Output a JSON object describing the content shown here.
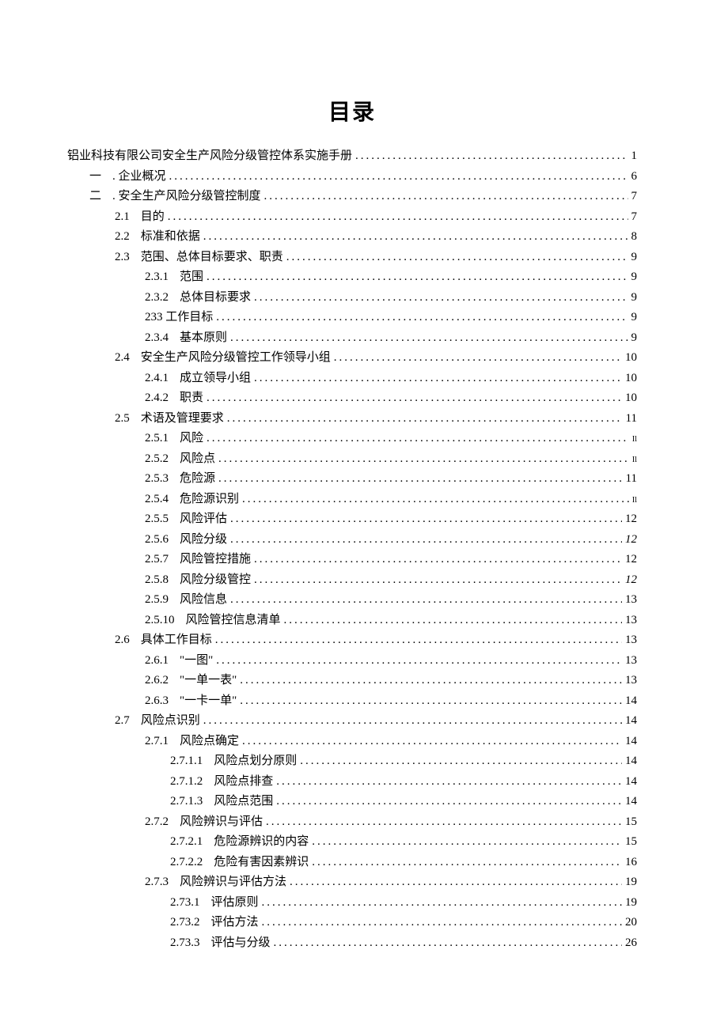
{
  "title": "目录",
  "toc": [
    {
      "level": 0,
      "num": "",
      "label": "铝业科技有限公司安全生产风险分级管控体系实施手册",
      "page": "1"
    },
    {
      "level": 1,
      "num": "一",
      "label": ". 企业概况",
      "page": "6"
    },
    {
      "level": 1,
      "num": "二",
      "label": ". 安全生产风险分级管控制度",
      "page": "7"
    },
    {
      "level": 2,
      "num": "2.1",
      "label": "目的",
      "page": "7"
    },
    {
      "level": 2,
      "num": "2.2",
      "label": "标准和依据",
      "page": "8"
    },
    {
      "level": 2,
      "num": "2.3",
      "label": "范围、总体目标要求、职责",
      "page": "9"
    },
    {
      "level": 3,
      "num": "2.3.1",
      "label": "范围",
      "page": "9"
    },
    {
      "level": 3,
      "num": "2.3.2",
      "label": "总体目标要求",
      "page": "9"
    },
    {
      "level": 3,
      "num": "",
      "label": "233 工作目标",
      "page": "9"
    },
    {
      "level": 3,
      "num": "2.3.4",
      "label": "基本原则",
      "page": "9"
    },
    {
      "level": 2,
      "num": "2.4",
      "label": "安全生产风险分级管控工作领导小组",
      "page": "10"
    },
    {
      "level": 3,
      "num": "2.4.1",
      "label": "成立领导小组",
      "page": "10"
    },
    {
      "level": 3,
      "num": "2.4.2",
      "label": "职责",
      "page": "10"
    },
    {
      "level": 2,
      "num": "2.5",
      "label": "术语及管理要求",
      "page": "11"
    },
    {
      "level": 3,
      "num": "2.5.1",
      "label": "风险",
      "page": "Il",
      "smallPage": true
    },
    {
      "level": 3,
      "num": "2.5.2",
      "label": "风险点",
      "page": "Il",
      "smallPage": true
    },
    {
      "level": 3,
      "num": "2.5.3",
      "label": "危险源",
      "page": "11"
    },
    {
      "level": 3,
      "num": "2.5.4",
      "label": "危险源识别",
      "page": "Il",
      "smallPage": true
    },
    {
      "level": 3,
      "num": "2.5.5",
      "label": "风险评估",
      "page": "12"
    },
    {
      "level": 3,
      "num": "2.5.6",
      "label": "风险分级",
      "page": "12",
      "italic": true
    },
    {
      "level": 3,
      "num": "2.5.7",
      "label": "风险管控措施",
      "page": "12"
    },
    {
      "level": 3,
      "num": "2.5.8",
      "label": "风险分级管控",
      "page": "12",
      "italic": true
    },
    {
      "level": 3,
      "num": "2.5.9",
      "label": "风险信息",
      "page": "13"
    },
    {
      "level": 3,
      "num": "2.5.10",
      "label": "风险管控信息清单",
      "page": "13"
    },
    {
      "level": 2,
      "num": "2.6",
      "label": "具体工作目标",
      "page": "13"
    },
    {
      "level": 3,
      "num": "2.6.1",
      "label": "\"一图\"",
      "page": "13"
    },
    {
      "level": 3,
      "num": "2.6.2",
      "label": "\"一单一表\"",
      "page": "13"
    },
    {
      "level": 3,
      "num": "2.6.3",
      "label": "\"一卡一单\"",
      "page": "14"
    },
    {
      "level": 2,
      "num": "2.7",
      "label": "风险点识别",
      "page": "14"
    },
    {
      "level": 3,
      "num": "2.7.1",
      "label": "风险点确定",
      "page": "14"
    },
    {
      "level": 4,
      "num": "2.7.1.1",
      "label": "风险点划分原则",
      "page": "14"
    },
    {
      "level": 4,
      "num": "2.7.1.2",
      "label": "风险点排查",
      "page": "14"
    },
    {
      "level": 4,
      "num": "2.7.1.3",
      "label": "风险点范围",
      "page": "14"
    },
    {
      "level": 3,
      "num": "2.7.2",
      "label": "风险辨识与评估",
      "page": "15"
    },
    {
      "level": 4,
      "num": "2.7.2.1",
      "label": "危险源辨识的内容",
      "page": "15"
    },
    {
      "level": 4,
      "num": "2.7.2.2",
      "label": "危险有害因素辨识",
      "page": "16"
    },
    {
      "level": 3,
      "num": "2.7.3",
      "label": "风险辨识与评估方法",
      "page": "19"
    },
    {
      "level": 4,
      "num": "2.73.1",
      "label": "评估原则",
      "page": "19"
    },
    {
      "level": 4,
      "num": "2.73.2",
      "label": "评估方法",
      "page": "20"
    },
    {
      "level": 4,
      "num": "2.73.3",
      "label": "评估与分级",
      "page": "26"
    }
  ]
}
